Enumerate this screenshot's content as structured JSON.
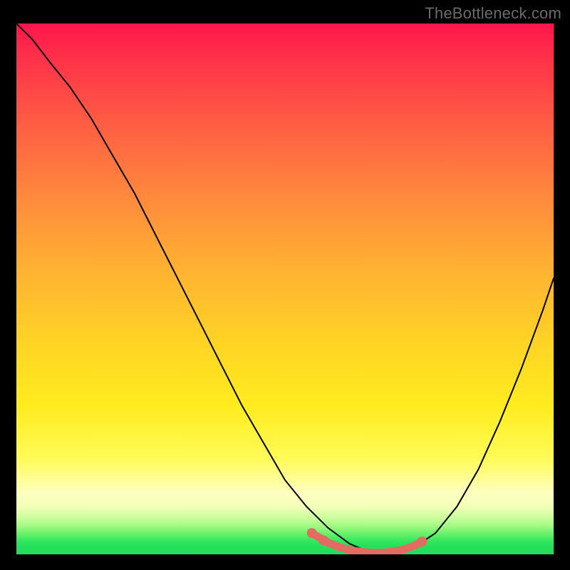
{
  "watermark": "TheBottleneck.com",
  "colors": {
    "background": "#000000",
    "curve": "#000000",
    "highlight": "#e46b62",
    "gradient_top": "#ff154c",
    "gradient_bottom": "#23de59"
  },
  "chart_data": {
    "type": "line",
    "title": "",
    "xlabel": "",
    "ylabel": "",
    "xlim": [
      0,
      100
    ],
    "ylim": [
      0,
      100
    ],
    "grid": false,
    "series": [
      {
        "name": "bottleneck-curve",
        "x": [
          0,
          3,
          6,
          10,
          14,
          18,
          22,
          26,
          30,
          34,
          38,
          42,
          46,
          50,
          54,
          58,
          62,
          65,
          68,
          71,
          74,
          78,
          82,
          86,
          90,
          94,
          98,
          100
        ],
        "y": [
          100,
          97,
          93,
          88,
          82,
          75,
          68,
          60,
          52,
          44,
          36,
          28,
          21,
          14,
          9,
          5,
          2,
          0.7,
          0.3,
          0.5,
          1.3,
          4,
          9,
          16,
          25,
          35,
          46,
          52
        ]
      },
      {
        "name": "optimal-range",
        "x": [
          55,
          58,
          60,
          62,
          64,
          66,
          68,
          70,
          72,
          74,
          75.5
        ],
        "y": [
          4.0,
          2.2,
          1.4,
          0.8,
          0.5,
          0.3,
          0.3,
          0.5,
          0.9,
          1.6,
          2.4
        ]
      }
    ],
    "markers": [
      {
        "name": "left-dot",
        "x": 55,
        "y": 4.0
      },
      {
        "name": "mid-dot",
        "x": 57.2,
        "y": 2.6
      },
      {
        "name": "right-dot",
        "x": 75.5,
        "y": 2.4
      }
    ],
    "annotations": []
  }
}
